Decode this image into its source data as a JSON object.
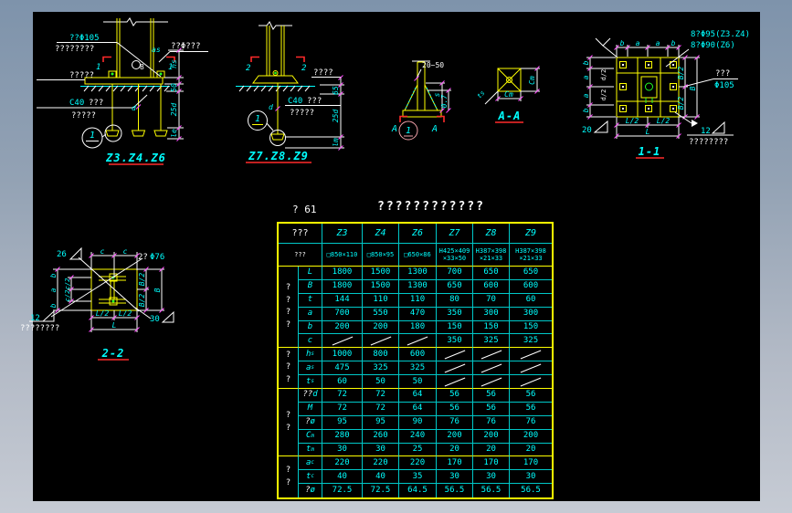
{
  "palette": {
    "yellow": "#ffff00",
    "cyan": "#00ffff",
    "white": "#ffffff",
    "red": "#ff2a2a",
    "magenta": "#ff4dff",
    "green": "#22ff22",
    "pink": "#f0a0a8",
    "canvas_bg": "#000000"
  },
  "details": {
    "z346": {
      "title": "Z3.Z4.Z6",
      "anchor_note": "??Φ105",
      "hatch_note": "????????",
      "embed_note": "?????",
      "c40": "C40",
      "c40_rest": "???",
      "grout_note": "?????",
      "top_note": "??Φ???",
      "as_dim": "as",
      "weld_num": "8",
      "d_dim": "d",
      "cut": "1",
      "bubble": "1",
      "dims": {
        "hs": "hs",
        "g50": "50",
        "d25": "25d",
        "le": "le"
      }
    },
    "z789": {
      "title": "Z7.Z8.Z9",
      "top_note": "????",
      "c40": "C40",
      "c40_rest": "???",
      "grout_note": "?????",
      "d_dim": "d",
      "cut": "2",
      "bubble": "1",
      "dims": {
        "g65": "65",
        "d25": "25d",
        "lm": "lm"
      }
    },
    "gusset": {
      "range": "20~50",
      "cut": "A",
      "bubble": "1",
      "dims": {
        "s": "s",
        "r07": "0.7"
      }
    },
    "aa": {
      "title": "A-A",
      "cm_b": "Cm",
      "cm_r": "Cm",
      "ts": "ts"
    },
    "p11": {
      "title": "1-1",
      "note_a": "8?Φ95(Z3.Z4)",
      "note_b": "8?Φ90(Z6)",
      "note_c": "???",
      "note_d": "Φ105",
      "top": [
        "b",
        "a",
        "a",
        "b"
      ],
      "left": [
        "b",
        "a",
        "a",
        "b"
      ],
      "inner": [
        "d/2",
        "d/2"
      ],
      "right": [
        "B/2",
        "B/2",
        "B"
      ],
      "bottom": [
        "L/2",
        "L/2",
        "L"
      ],
      "weld20": "20",
      "weld12": "12",
      "hatch": "????????"
    },
    "p22": {
      "title": "2-2",
      "note_n": "2?",
      "note_d": "Φ76",
      "weld26": "26",
      "weld12": "12",
      "weld30": "30",
      "hatch": "????????",
      "top": [
        "c",
        "c"
      ],
      "left": [
        "b",
        "a",
        "b"
      ],
      "inner": [
        "c/2",
        "c/2"
      ],
      "right": [
        "B/2",
        "B/2",
        "B"
      ],
      "bottom": [
        "L/2",
        "L/2",
        "L"
      ]
    }
  },
  "table": {
    "ref": "? 61",
    "title": "????????????",
    "corner": "???",
    "columns": [
      "Z3",
      "Z4",
      "Z6",
      "Z7",
      "Z8",
      "Z9"
    ],
    "section": {
      "label": "???",
      "values": [
        "□850×110",
        "□850×95",
        "□650×86",
        "H425×409\n×33×50",
        "H387×398\n×21×33",
        "H387×398\n×21×33"
      ]
    },
    "groups": [
      {
        "label": "????",
        "rows": [
          {
            "sym": "L",
            "values": [
              "1800",
              "1500",
              "1300",
              "700",
              "650",
              "650"
            ]
          },
          {
            "sym": "B",
            "values": [
              "1800",
              "1500",
              "1300",
              "650",
              "600",
              "600"
            ]
          },
          {
            "sym": "t",
            "values": [
              "144",
              "110",
              "110",
              "80",
              "70",
              "60"
            ]
          },
          {
            "sym": "a",
            "values": [
              "700",
              "550",
              "470",
              "350",
              "300",
              "300"
            ]
          },
          {
            "sym": "b",
            "values": [
              "200",
              "200",
              "180",
              "150",
              "150",
              "150"
            ]
          },
          {
            "sym": "c",
            "values": [
              "/",
              "/",
              "/",
              "350",
              "325",
              "325"
            ]
          }
        ]
      },
      {
        "label": "???",
        "rows": [
          {
            "sym": "h",
            "sub": "s",
            "values": [
              "1000",
              "800",
              "600",
              "/",
              "/",
              "/"
            ]
          },
          {
            "sym": "a",
            "sub": "s",
            "values": [
              "475",
              "325",
              "325",
              "/",
              "/",
              "/"
            ]
          },
          {
            "sym": "t",
            "sub": "s",
            "values": [
              "60",
              "50",
              "50",
              "/",
              "/",
              "/"
            ]
          }
        ]
      },
      {
        "label": "??",
        "rows": [
          {
            "pre": "??",
            "sym": "d",
            "values": [
              "72",
              "72",
              "64",
              "56",
              "56",
              "56"
            ]
          },
          {
            "sym": "M",
            "values": [
              "72",
              "72",
              "64",
              "56",
              "56",
              "56"
            ]
          },
          {
            "pre": "?",
            "sym": "ø",
            "values": [
              "95",
              "95",
              "90",
              "76",
              "76",
              "76"
            ]
          },
          {
            "sym": "C",
            "sub": "m",
            "values": [
              "280",
              "260",
              "240",
              "200",
              "200",
              "200"
            ]
          },
          {
            "sym": "t",
            "sub": "m",
            "values": [
              "30",
              "30",
              "25",
              "20",
              "20",
              "20"
            ]
          }
        ]
      },
      {
        "label": "??",
        "rows": [
          {
            "sym": "a",
            "sub": "c",
            "values": [
              "220",
              "220",
              "220",
              "170",
              "170",
              "170"
            ]
          },
          {
            "sym": "t",
            "sub": "c",
            "values": [
              "40",
              "40",
              "35",
              "30",
              "30",
              "30"
            ]
          },
          {
            "pre": "?",
            "sym": "ø",
            "values": [
              "72.5",
              "72.5",
              "64.5",
              "56.5",
              "56.5",
              "56.5"
            ]
          }
        ]
      }
    ]
  }
}
